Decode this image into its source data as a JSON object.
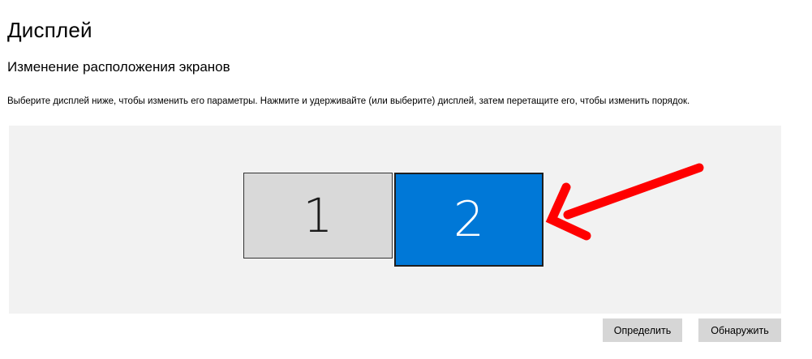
{
  "page": {
    "title": "Дисплей"
  },
  "arrangement": {
    "section_title": "Изменение расположения экранов",
    "description": "Выберите дисплей ниже, чтобы изменить его параметры. Нажмите и удерживайте (или выберите) дисплей, затем перетащите его, чтобы изменить порядок.",
    "displays": [
      {
        "label": "1",
        "selected": false,
        "color": "#d9d9d9"
      },
      {
        "label": "2",
        "selected": true,
        "color": "#0078d7"
      }
    ],
    "annotation": {
      "icon": "red-arrow-icon",
      "color": "#ff0000",
      "points_to": "display-2"
    }
  },
  "buttons": {
    "identify_label": "Определить",
    "detect_label": "Обнаружить"
  },
  "colors": {
    "accent": "#0078d7",
    "area_background": "#f2f2f2",
    "button_background": "#d6d6d6"
  }
}
